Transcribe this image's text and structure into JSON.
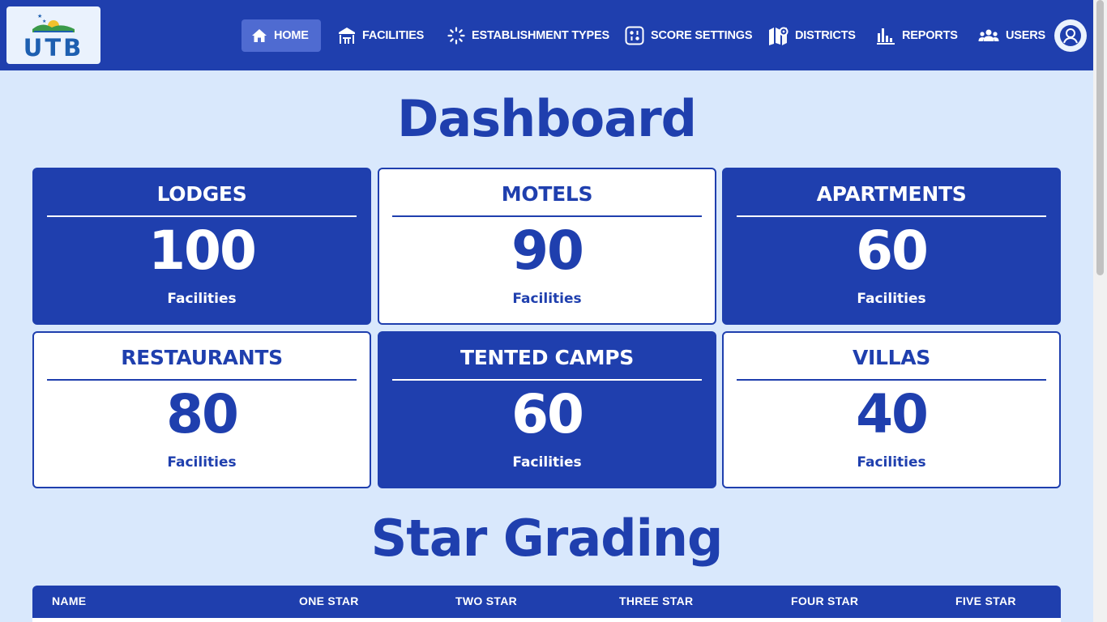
{
  "brand": {
    "logo_text": "UTB"
  },
  "nav": [
    {
      "label": "HOME",
      "icon": "home-icon"
    },
    {
      "label": "FACILITIES",
      "icon": "facilities-icon"
    },
    {
      "label": "ESTABLISHMENT TYPES",
      "icon": "establishment-icon"
    },
    {
      "label": "SCORE SETTINGS",
      "icon": "score-settings-icon"
    },
    {
      "label": "DISTRICTS",
      "icon": "map-icon"
    },
    {
      "label": "REPORTS",
      "icon": "bar-chart-icon"
    },
    {
      "label": "USERS",
      "icon": "users-icon"
    }
  ],
  "profile": {
    "icon": "user-circle-icon"
  },
  "page_title": "Dashboard",
  "cards": [
    {
      "title": "LODGES",
      "count": "100",
      "subtitle": "Facilities"
    },
    {
      "title": "MOTELS",
      "count": "90",
      "subtitle": "Facilities"
    },
    {
      "title": "APARTMENTS",
      "count": "60",
      "subtitle": "Facilities"
    },
    {
      "title": "RESTAURANTS",
      "count": "80",
      "subtitle": "Facilities"
    },
    {
      "title": "TENTED CAMPS",
      "count": "60",
      "subtitle": "Facilities"
    },
    {
      "title": "VILLAS",
      "count": "40",
      "subtitle": "Facilities"
    }
  ],
  "star_grading": {
    "title": "Star Grading",
    "columns": [
      "NAME",
      "ONE STAR",
      "TWO STAR",
      "THREE STAR",
      "FOUR STAR",
      "FIVE STAR"
    ]
  },
  "colors": {
    "primary": "#1f3fae",
    "background": "#d9e8fc",
    "active_nav": "#4f6bd1"
  }
}
